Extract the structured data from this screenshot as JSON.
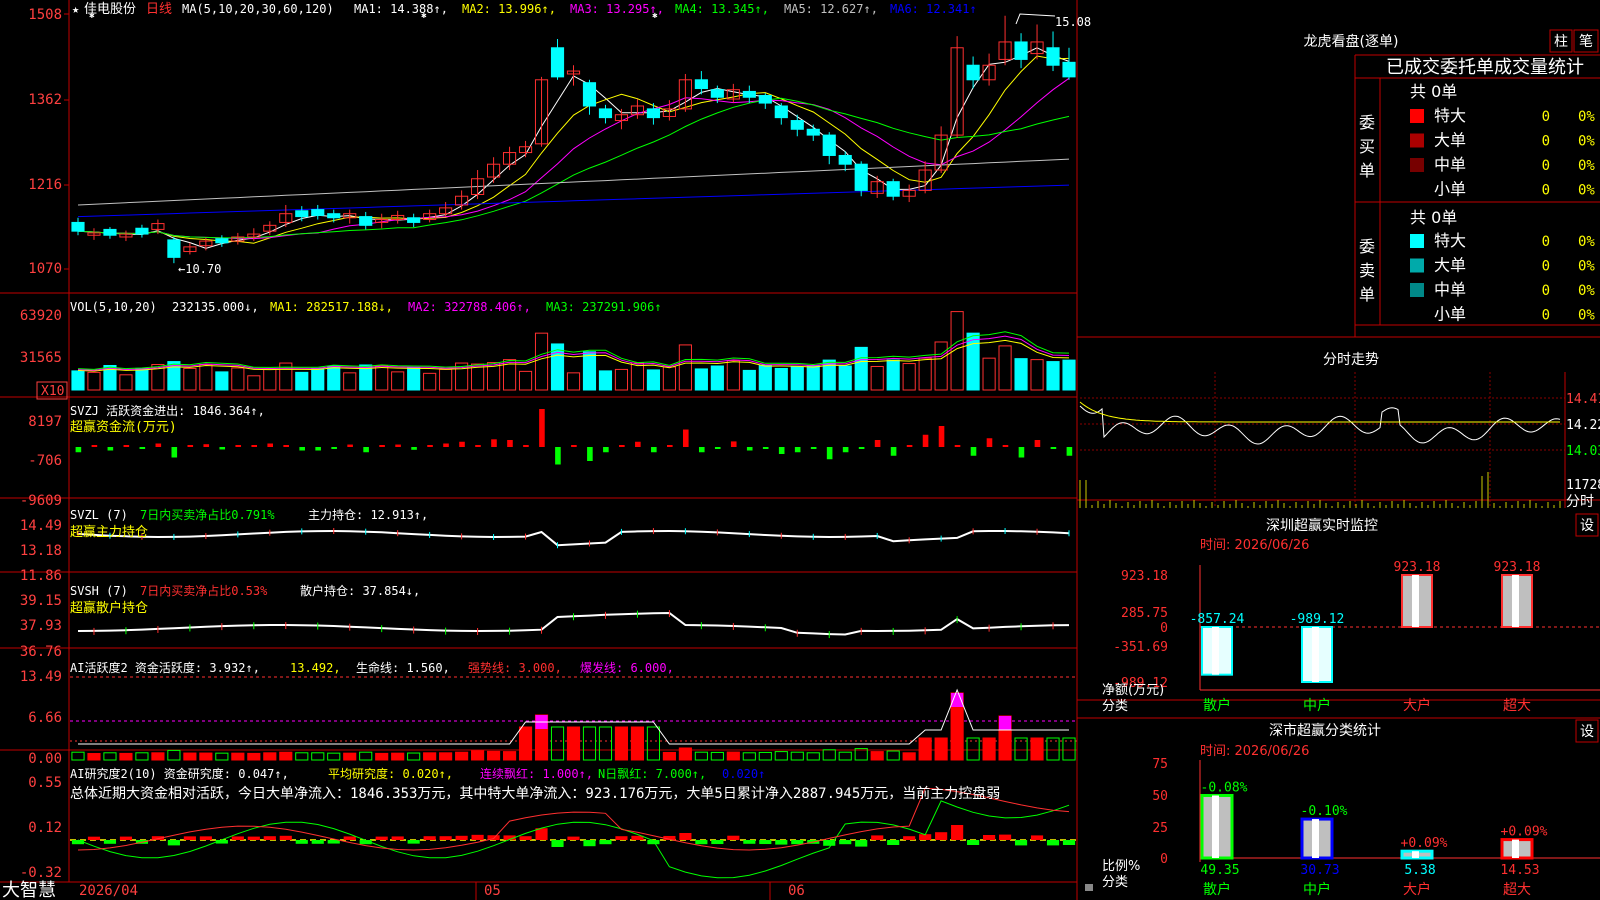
{
  "header": {
    "star": "★",
    "stock_name": "佳电股份",
    "period": "日线",
    "ma_label": "MA(5,10,20,30,60,120)",
    "ma": [
      {
        "label": "MA1: 14.388↑,",
        "color": "#ffffff"
      },
      {
        "label": "MA2: 13.996↑,",
        "color": "#ffff00"
      },
      {
        "label": "MA3: 13.295↑,",
        "color": "#ff00ff"
      },
      {
        "label": "MA4: 13.345↑,",
        "color": "#00ff00"
      },
      {
        "label": "MA5: 12.627↑,",
        "color": "#c0c0c0"
      },
      {
        "label": "MA6: 12.341↑",
        "color": "#0000ff"
      }
    ],
    "high_mark": "15.08",
    "low_mark": "←10.70"
  },
  "main_axis": [
    "1508",
    "1362",
    "1216",
    "1070"
  ],
  "vol": {
    "label": "VOL(5,10,20)",
    "value": "232135.000↓,",
    "ma": [
      {
        "label": "MA1: 282517.188↓,",
        "color": "#ffff00"
      },
      {
        "label": "MA2: 322788.406↑,",
        "color": "#ff00ff"
      },
      {
        "label": "MA3: 237291.906↑",
        "color": "#00ff00"
      }
    ],
    "axis": [
      "63920",
      "31565",
      "X10"
    ]
  },
  "svzj": {
    "label": "SVZJ  活跃资金进出: 1846.364↑,",
    "sub": "超赢资金流(万元)",
    "axis": [
      "8197",
      "-706",
      "-9609"
    ]
  },
  "svzl": {
    "label": "SVZL (7)",
    "part2": "7日内买卖净占比0.791%",
    "part3": "主力持仓: 12.913↑,",
    "sub": "超赢主力持仓",
    "axis": [
      "14.49",
      "13.18",
      "11.86"
    ]
  },
  "svsh": {
    "label": "SVSH (7)",
    "part2": "7日内买卖净占比0.53%",
    "part3": "散户持仓: 37.854↓,",
    "sub": "超赢散户持仓",
    "axis": [
      "39.15",
      "37.93",
      "36.76"
    ]
  },
  "ai2": {
    "label": "AI活跃度2 资金活跃度: 3.932↑,",
    "v2": "13.492,",
    "v3": "生命线: 1.560,",
    "v4": "强势线: 3.000,",
    "v5": "爆发线: 6.000,",
    "axis": [
      "13.49",
      "6.66",
      "0.00"
    ]
  },
  "ai_research": {
    "label": "AI研究度2(10) 资金研究度: 0.047↑,",
    "v2": "平均研究度: 0.020↑,",
    "v3": "连续飘红: 1.000↑,",
    "v4": "N日飘红: 7.000↑,",
    "v5": "0.020↑",
    "summary": "总体近期大资金相对活跃，今日大单净流入：1846.353万元，其中特大单净流入：923.176万元，大单5日累计净入2887.945万元，当前主力控盘弱",
    "axis": [
      "0.55",
      "0.12",
      "-0.32"
    ]
  },
  "bottom": {
    "brand": "大智慧",
    "date_start": "2026/04",
    "m05": "05",
    "m06": "06"
  },
  "right": {
    "lhb_title": "龙虎看盘(逐单)",
    "btn_zhu": "柱",
    "btn_bi": "笔",
    "tabs": "已成交委托单成交量统计",
    "buy_total": "共 0单",
    "buy_label": "委买单",
    "sell_total": "共 0单",
    "sell_label": "委卖单",
    "buy_rows": [
      {
        "name": "特大",
        "count": "0",
        "pct": "0%",
        "color": "#ff0000"
      },
      {
        "name": "大单",
        "count": "0",
        "pct": "0%",
        "color": "#aa0000"
      },
      {
        "name": "中单",
        "count": "0",
        "pct": "0%",
        "color": "#770000"
      },
      {
        "name": "小单",
        "count": "0",
        "pct": "0%",
        "color": ""
      }
    ],
    "sell_rows": [
      {
        "name": "特大",
        "count": "0",
        "pct": "0%",
        "color": "#00ffff"
      },
      {
        "name": "大单",
        "count": "0",
        "pct": "0%",
        "color": "#00aaaa"
      },
      {
        "name": "中单",
        "count": "0",
        "pct": "0%",
        "color": "#008888"
      },
      {
        "name": "小单",
        "count": "0",
        "pct": "0%",
        "color": ""
      }
    ],
    "fenshi_title": "分时走势",
    "fenshi_axis": [
      "14.41",
      "14.22",
      "14.03"
    ],
    "fenshi_vol": "11728",
    "fenshi_vol_label": "分时",
    "monitor_title": "深圳超赢实时监控",
    "monitor_btn": "设",
    "monitor_time": "时间: 2026/06/26",
    "monitor_axis": [
      "923.18",
      "285.75",
      "0",
      "-351.69",
      "-989.12"
    ],
    "monitor_axis_title": "净额(万元)",
    "monitor_axis_title2": "分类",
    "monitor_cats": [
      "散户",
      "中户",
      "大户",
      "超大"
    ],
    "monitor_values": [
      -857.24,
      -989.12,
      923.18,
      923.18
    ],
    "monitor_labels": [
      "-857.24",
      "-989.12",
      "923.18",
      "923.18"
    ],
    "class_title": "深市超赢分类统计",
    "class_btn": "设",
    "class_time": "时间: 2026/06/26",
    "class_axis": [
      "75",
      "50",
      "25",
      "0"
    ],
    "class_axis_title": "比例%",
    "class_axis_title2": "分类",
    "class_cats": [
      "散户",
      "中户",
      "大户",
      "超大"
    ],
    "class_values": [
      49.35,
      30.73,
      5.38,
      14.53
    ],
    "class_value_labels": [
      "49.35",
      "30.73",
      "5.38",
      "14.53"
    ],
    "class_change": [
      "-0.08%",
      "-0.10%",
      "+0.09%",
      "+0.09%"
    ]
  },
  "colors": {
    "up": "#ff3030",
    "down": "#00ffff",
    "border": "#c00000",
    "axis_text": "#ff4040"
  },
  "chart_data": {
    "type": "candlestick",
    "note_series": "daily prices ×100 per axis",
    "ylim": [
      1070,
      1508
    ],
    "candles": [
      [
        1150,
        1135,
        1158,
        1128
      ],
      [
        1128,
        1132,
        1140,
        1120
      ],
      [
        1138,
        1128,
        1142,
        1122
      ],
      [
        1125,
        1130,
        1136,
        1118
      ],
      [
        1140,
        1130,
        1146,
        1124
      ],
      [
        1138,
        1148,
        1155,
        1130
      ],
      [
        1120,
        1090,
        1125,
        1080
      ],
      [
        1100,
        1108,
        1115,
        1095
      ],
      [
        1110,
        1118,
        1124,
        1102
      ],
      [
        1122,
        1115,
        1128,
        1108
      ],
      [
        1118,
        1125,
        1132,
        1112
      ],
      [
        1125,
        1130,
        1140,
        1118
      ],
      [
        1135,
        1145,
        1152,
        1128
      ],
      [
        1150,
        1165,
        1180,
        1142
      ],
      [
        1170,
        1160,
        1178,
        1152
      ],
      [
        1172,
        1162,
        1180,
        1155
      ],
      [
        1165,
        1158,
        1172,
        1150
      ],
      [
        1158,
        1165,
        1172,
        1148
      ],
      [
        1160,
        1145,
        1168,
        1138
      ],
      [
        1150,
        1155,
        1165,
        1140
      ],
      [
        1155,
        1162,
        1170,
        1148
      ],
      [
        1158,
        1150,
        1165,
        1142
      ],
      [
        1155,
        1165,
        1172,
        1150
      ],
      [
        1165,
        1175,
        1185,
        1160
      ],
      [
        1180,
        1195,
        1205,
        1172
      ],
      [
        1198,
        1225,
        1240,
        1190
      ],
      [
        1228,
        1250,
        1262,
        1218
      ],
      [
        1250,
        1270,
        1280,
        1240
      ],
      [
        1270,
        1280,
        1290,
        1262
      ],
      [
        1285,
        1395,
        1400,
        1280
      ],
      [
        1450,
        1400,
        1465,
        1395
      ],
      [
        1405,
        1410,
        1420,
        1385
      ],
      [
        1390,
        1350,
        1395,
        1335
      ],
      [
        1345,
        1330,
        1352,
        1320
      ],
      [
        1325,
        1335,
        1345,
        1310
      ],
      [
        1335,
        1350,
        1362,
        1328
      ],
      [
        1345,
        1330,
        1355,
        1318
      ],
      [
        1332,
        1345,
        1360,
        1325
      ],
      [
        1345,
        1395,
        1405,
        1340
      ],
      [
        1395,
        1380,
        1410,
        1370
      ],
      [
        1378,
        1365,
        1385,
        1355
      ],
      [
        1362,
        1378,
        1388,
        1356
      ],
      [
        1375,
        1365,
        1385,
        1355
      ],
      [
        1368,
        1355,
        1372,
        1345
      ],
      [
        1350,
        1330,
        1355,
        1318
      ],
      [
        1325,
        1310,
        1335,
        1298
      ],
      [
        1310,
        1300,
        1318,
        1290
      ],
      [
        1300,
        1265,
        1305,
        1250
      ],
      [
        1265,
        1250,
        1272,
        1238
      ],
      [
        1250,
        1205,
        1255,
        1195
      ],
      [
        1200,
        1220,
        1230,
        1192
      ],
      [
        1220,
        1195,
        1225,
        1188
      ],
      [
        1195,
        1205,
        1215,
        1185
      ],
      [
        1205,
        1240,
        1255,
        1200
      ],
      [
        1240,
        1300,
        1315,
        1235
      ],
      [
        1300,
        1450,
        1470,
        1295
      ],
      [
        1420,
        1395,
        1435,
        1380
      ],
      [
        1395,
        1420,
        1440,
        1385
      ],
      [
        1430,
        1460,
        1505,
        1420
      ],
      [
        1460,
        1430,
        1475,
        1415
      ],
      [
        1440,
        1460,
        1490,
        1430
      ],
      [
        1450,
        1420,
        1478,
        1410
      ],
      [
        1425,
        1400,
        1450,
        1395
      ]
    ]
  }
}
